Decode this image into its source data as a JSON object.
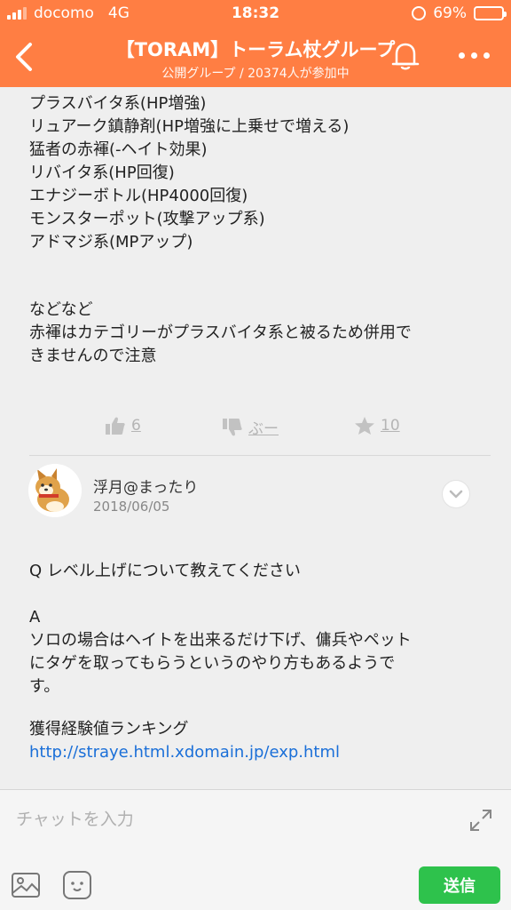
{
  "status_bar": {
    "carrier": "docomo",
    "network": "4G",
    "time": "18:32",
    "battery_percent": "69%",
    "battery_level": 0.69
  },
  "header": {
    "title": "【TORAM】トーラム杖グループ",
    "subtitle": "公開グループ / 20374人が参加中",
    "back_icon": "chevron-left-icon",
    "bell_icon": "bell-icon",
    "more_icon": "more-dots-icon"
  },
  "post1": {
    "lines": [
      "プラスバイタ系(HP増強)",
      "リュアーク鎮静剤(HP増強に上乗せで増える)",
      "猛者の赤褌(-ヘイト効果)",
      "リバイタ系(HP回復)",
      "エナジーボトル(HP4000回復)",
      "モンスターポット(攻撃アップ系)",
      "アドマジ系(MPアップ)"
    ],
    "footer_lines": [
      "などなど",
      "赤褌はカテゴリーがプラスバイタ系と被るため併用で",
      "きませんので注意"
    ],
    "reactions": {
      "like_count": "6",
      "boo_label": "ぶー",
      "favorite_count": "10"
    }
  },
  "post2": {
    "author": "浮月@まったり",
    "date": "2018/06/05",
    "question": "Q レベル上げについて教えてください",
    "answer_label": "A",
    "answer_lines": [
      "ソロの場合はヘイトを出来るだけ下げ、傭兵やペット",
      "にタゲを取ってもらうというのやり方もあるようで",
      "す。"
    ],
    "ranking_label": "獲得経験値ランキング",
    "ranking_link": "http://straye.html.xdomain.jp/exp.html"
  },
  "composer": {
    "placeholder": "チャットを入力",
    "send_label": "送信"
  },
  "colors": {
    "header_bg": "#ff7e43",
    "send_bg": "#2ec24c",
    "link": "#1a6fd8"
  }
}
